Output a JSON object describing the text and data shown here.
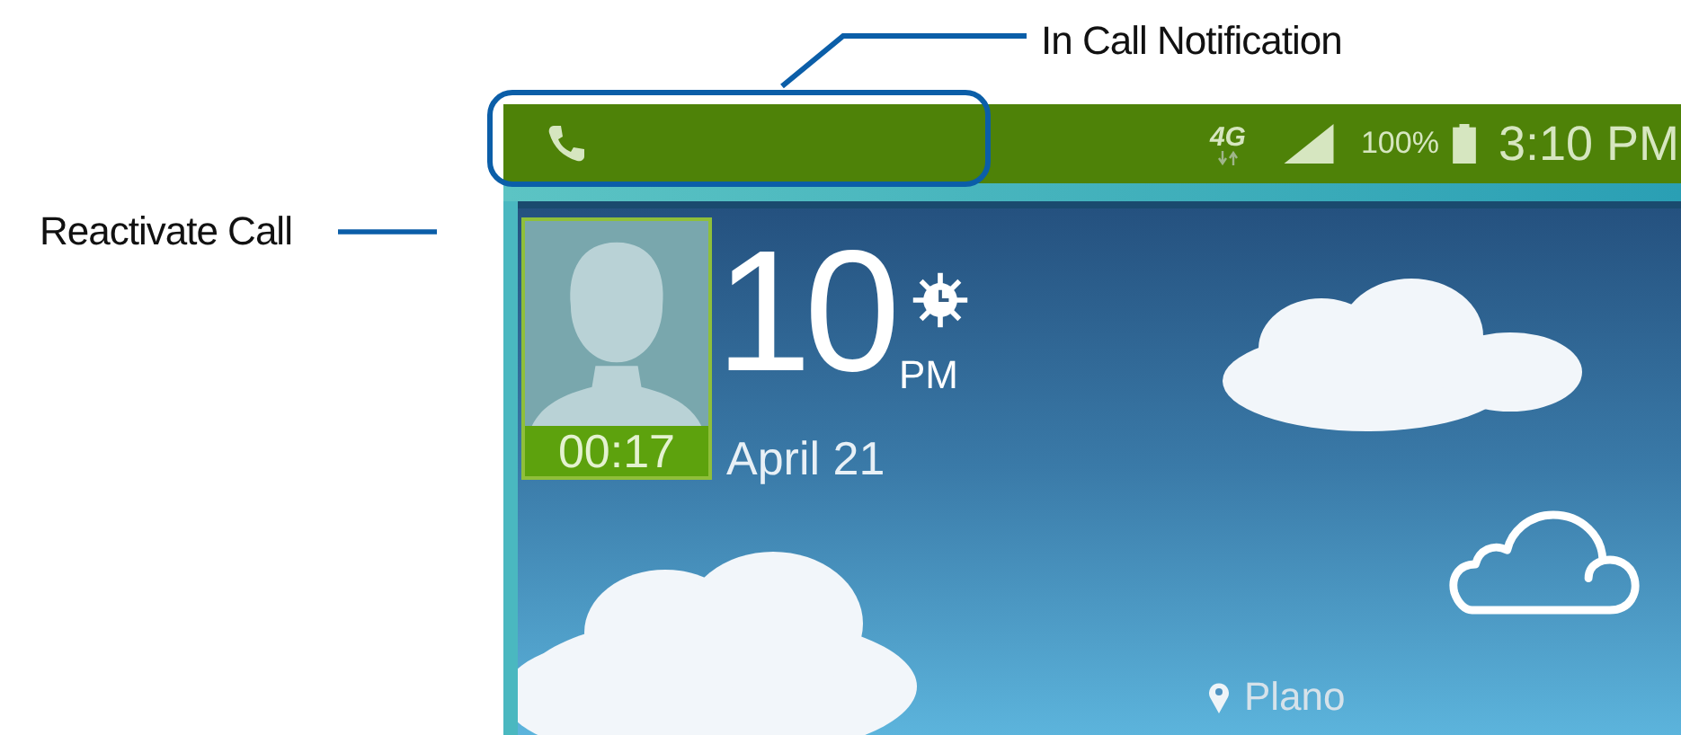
{
  "annotations": [
    {
      "label": "In Call Notification"
    },
    {
      "label": "Reactivate Call"
    }
  ],
  "status_bar": {
    "network": "4G",
    "battery": "100%",
    "time": "3:10 PM"
  },
  "call_thumbnail": {
    "duration": "00:17"
  },
  "clock_widget": {
    "time": "10",
    "period": "PM",
    "date": "April 21"
  },
  "weather": {
    "location": "Plano"
  }
}
